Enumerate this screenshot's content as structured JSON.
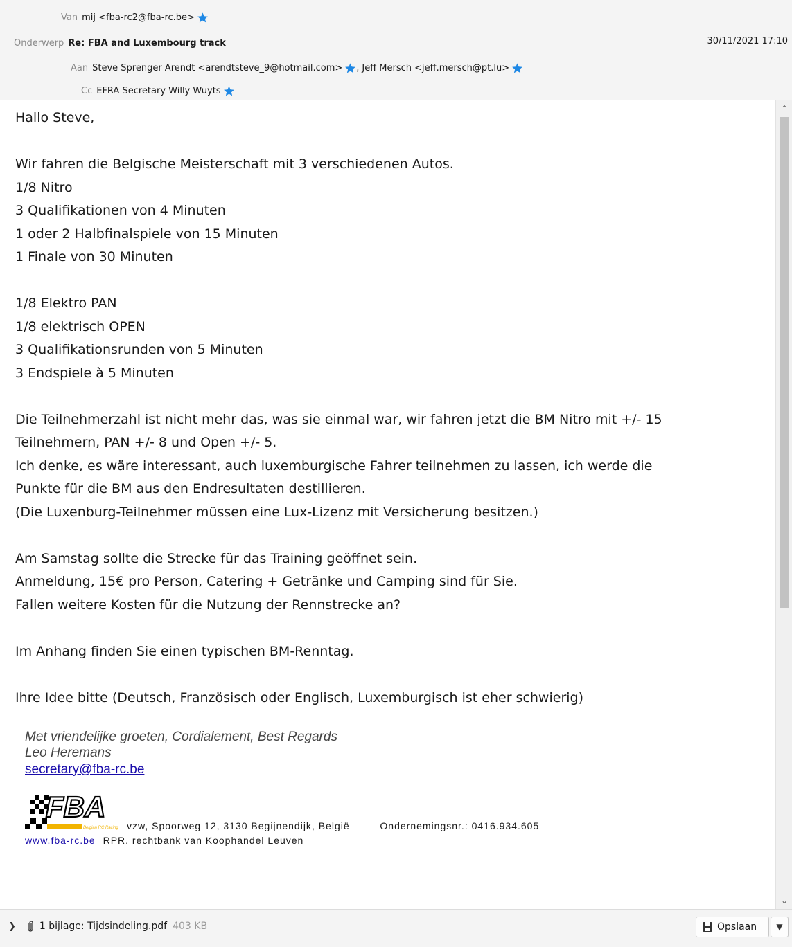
{
  "header": {
    "from": {
      "label": "Van",
      "value": "mij <fba-rc2@fba-rc.be>"
    },
    "subject": {
      "label": "Onderwerp",
      "value": "Re: FBA and Luxembourg track"
    },
    "date": "30/11/2021 17:10",
    "to": {
      "label": "Aan",
      "recipients": [
        "Steve Sprenger Arendt <arendtsteve_9@hotmail.com>",
        "Jeff Mersch <jeff.mersch@pt.lu>"
      ],
      "separator": ","
    },
    "cc": {
      "label": "Cc",
      "value": "EFRA Secretary Willy Wuyts"
    }
  },
  "body": {
    "greeting": "Hallo Steve,",
    "para1": [
      "Wir fahren die Belgische Meisterschaft mit 3 verschiedenen Autos.",
      "1/8 Nitro",
      "3 Qualifikationen von 4 Minuten",
      "1 oder 2 Halbfinalspiele von 15 Minuten",
      "1 Finale von 30 Minuten"
    ],
    "para2": [
      "1/8 Elektro PAN",
      "1/8 elektrisch OPEN",
      "3 Qualifikationsrunden von 5 Minuten",
      "3 Endspiele à 5 Minuten"
    ],
    "para3": [
      "Die Teilnehmerzahl ist nicht mehr das, was sie einmal war, wir fahren jetzt die BM Nitro mit +/- 15",
      "Teilnehmern, PAN +/- 8 und Open +/- 5.",
      "Ich denke, es wäre interessant, auch luxemburgische Fahrer teilnehmen zu lassen, ich werde die",
      "Punkte für die BM aus den Endresultaten destillieren.",
      "(Die Luxenburg-Teilnehmer müssen eine Lux-Lizenz mit Versicherung besitzen.)"
    ],
    "para4": [
      "Am Samstag sollte die Strecke für das Training geöffnet sein.",
      "Anmeldung, 15€ pro Person, Catering + Getränke und Camping sind für Sie.",
      "Fallen weitere Kosten für die Nutzung der Rennstrecke an?"
    ],
    "para5": "Im Anhang finden Sie einen typischen BM-Renntag.",
    "para6": "Ihre Idee bitte (Deutsch, Französisch oder Englisch, Luxemburgisch ist eher schwierig)"
  },
  "signature": {
    "regards": "Met vriendelijke groeten, Cordialement, Best Regards",
    "name": "Leo Heremans",
    "email": "secretary@fba-rc.be",
    "logo_text": "FBA",
    "logo_tagline": "Belgian RC Racing",
    "address": "vzw, Spoorweg 12, 3130 Begijnendijk, België",
    "company_no": "Ondernemingsnr.: 0416.934.605",
    "website": "www.fba-rc.be",
    "rpr": "RPR. rechtbank van Koophandel Leuven"
  },
  "attachment": {
    "label": "1 bijlage: Tijdsindeling.pdf",
    "size": "403 KB",
    "save_label": "Opslaan"
  },
  "icons": {
    "star_color": "#1e88e5",
    "expand": "chevron-right-icon",
    "clip": "paperclip-icon",
    "save": "save-icon",
    "menu": "chevron-down-icon"
  }
}
